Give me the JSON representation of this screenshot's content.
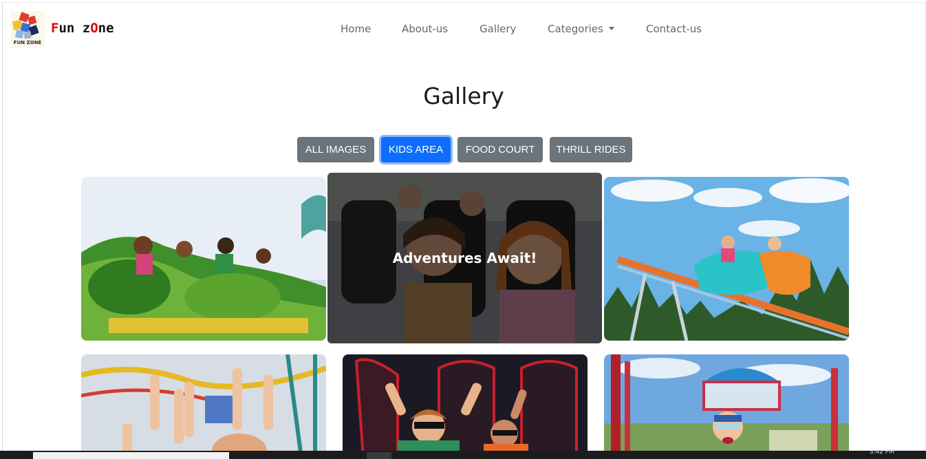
{
  "brand": {
    "logo_caption": "FUN ZONE",
    "name_parts": [
      "F",
      "un z",
      "O",
      "ne"
    ]
  },
  "nav": {
    "home": "Home",
    "about": "About-us",
    "gallery": "Gallery",
    "categories": "Categories",
    "contact": "Contact-us"
  },
  "page": {
    "title": "Gallery"
  },
  "filters": {
    "all": "ALL IMAGES",
    "kids": "KIDS AREA",
    "food": "FOOD COURT",
    "thrill": "THRILL RIDES",
    "active": "KIDS AREA"
  },
  "gallery": {
    "hover_caption": "Adventures Await!",
    "images": [
      "caterpillar-coaster-kids",
      "go-kart-girls",
      "swing-ride-sky",
      "raised-hands-coaster",
      "3d-ride-kids",
      "ferris-wheel-boy"
    ]
  },
  "taskbar": {
    "clock": "3:42 PM"
  },
  "colors": {
    "brand_red": "#e00000",
    "active_filter": "#0d6efd",
    "filter_gray": "#6b737b"
  }
}
